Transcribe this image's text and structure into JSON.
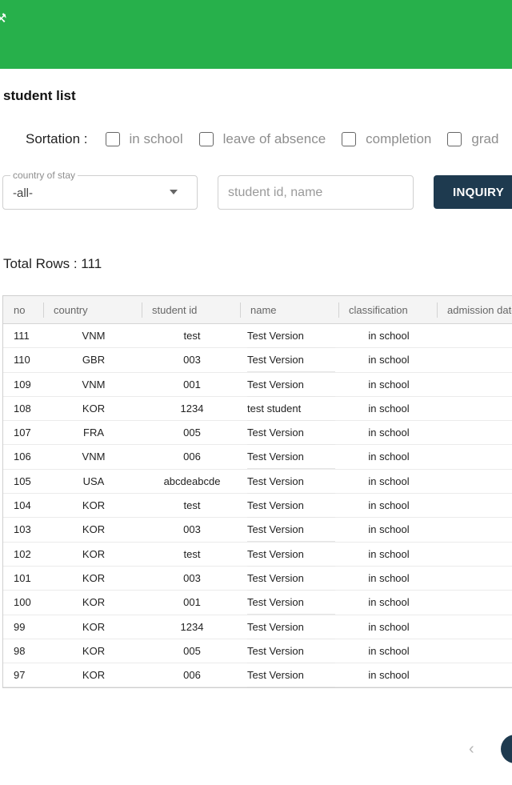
{
  "header": {
    "icon": "tool-icon"
  },
  "page_title": "student list",
  "sortation": {
    "label": "Sortation :",
    "options": [
      "in school",
      "leave of absence",
      "completion",
      "grad"
    ]
  },
  "filters": {
    "country_label": "country of stay",
    "country_value": "-all-",
    "search_placeholder": "student id, name",
    "inquiry_label": "INQUIRY"
  },
  "total_rows": "Total Rows : 111",
  "table": {
    "columns": [
      "no",
      "country",
      "student id",
      "name",
      "classification",
      "admission date"
    ],
    "rows": [
      [
        "111",
        "VNM",
        "test",
        "Test Version",
        "in school"
      ],
      [
        "110",
        "GBR",
        "003",
        "Test Version",
        "in school"
      ],
      [
        "109",
        "VNM",
        "001",
        "Test Version",
        "in school"
      ],
      [
        "108",
        "KOR",
        "1234",
        "test student",
        "in school"
      ],
      [
        "107",
        "FRA",
        "005",
        "Test Version",
        "in school"
      ],
      [
        "106",
        "VNM",
        "006",
        "Test Version",
        "in school"
      ],
      [
        "105",
        "USA",
        "abcdeabcde",
        "Test Version",
        "in school"
      ],
      [
        "104",
        "KOR",
        "test",
        "Test Version",
        "in school"
      ],
      [
        "103",
        "KOR",
        "003",
        "Test Version",
        "in school"
      ],
      [
        "102",
        "KOR",
        "test",
        "Test Version",
        "in school"
      ],
      [
        "101",
        "KOR",
        "003",
        "Test Version",
        "in school"
      ],
      [
        "100",
        "KOR",
        "001",
        "Test Version",
        "in school"
      ],
      [
        "99",
        "KOR",
        "1234",
        "Test Version",
        "in school"
      ],
      [
        "98",
        "KOR",
        "005",
        "Test Version",
        "in school"
      ],
      [
        "97",
        "KOR",
        "006",
        "Test Version",
        "in school"
      ]
    ]
  },
  "pagination": {
    "prev_icon": "chevron-left-icon",
    "prev_glyph": "‹"
  },
  "colors": {
    "header": "#27b04b",
    "button": "#1e3a4f"
  }
}
